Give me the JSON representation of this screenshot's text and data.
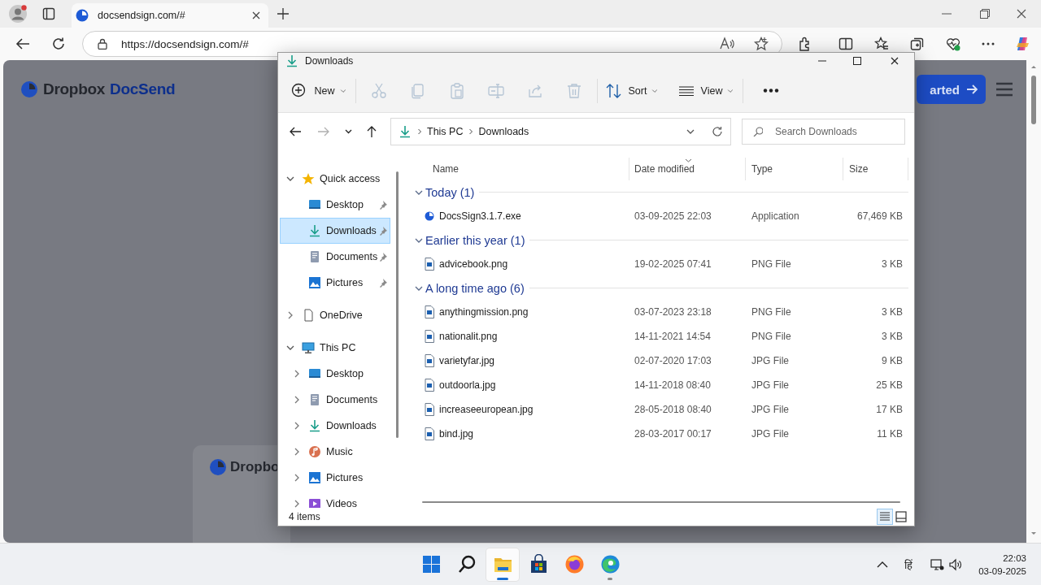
{
  "browser": {
    "tab_title": "docsendsign.com/#",
    "url": "https://docsendsign.com/#"
  },
  "webpage": {
    "logo_brand": "Dropbox",
    "logo_product": "DocSend",
    "header_button": "arted",
    "card_logo": "Dropbo"
  },
  "explorer": {
    "title": "Downloads",
    "toolbar": [
      {
        "kind": "new",
        "label": "New",
        "disabled": false
      },
      {
        "kind": "cut",
        "disabled": true
      },
      {
        "kind": "copy",
        "disabled": true
      },
      {
        "kind": "paste",
        "disabled": true
      },
      {
        "kind": "rename",
        "disabled": true
      },
      {
        "kind": "share",
        "disabled": true
      },
      {
        "kind": "delete",
        "disabled": true
      },
      {
        "kind": "sort",
        "label": "Sort",
        "disabled": false
      },
      {
        "kind": "view",
        "label": "View",
        "disabled": false
      },
      {
        "kind": "more",
        "disabled": false
      }
    ],
    "nav_buttons": [
      {
        "kind": "back",
        "disabled": false
      },
      {
        "kind": "forward",
        "disabled": true
      },
      {
        "kind": "recent",
        "disabled": false
      },
      {
        "kind": "up",
        "disabled": false
      }
    ],
    "breadcrumb": [
      "This PC",
      "Downloads"
    ],
    "search": {
      "placeholder": "Search Downloads"
    },
    "sidebar": [
      {
        "label": "Quick access",
        "kind": "star",
        "expanded": true,
        "selected": false,
        "children": [
          {
            "label": "Desktop",
            "kind": "desktop",
            "pinned": true,
            "selected": false
          },
          {
            "label": "Downloads",
            "kind": "download",
            "pinned": true,
            "selected": true
          },
          {
            "label": "Documents",
            "kind": "documents",
            "pinned": true,
            "selected": false
          },
          {
            "label": "Pictures",
            "kind": "pictures",
            "pinned": true,
            "selected": false
          }
        ]
      },
      {
        "label": "OneDrive",
        "kind": "file",
        "expanded": false,
        "selected": false
      },
      {
        "label": "This PC",
        "kind": "pc",
        "expanded": true,
        "selected": false,
        "children": [
          {
            "label": "Desktop",
            "kind": "desktop",
            "expanded": false,
            "selected": false
          },
          {
            "label": "Documents",
            "kind": "documents",
            "expanded": false,
            "selected": false
          },
          {
            "label": "Downloads",
            "kind": "download",
            "expanded": false,
            "selected": false
          },
          {
            "label": "Music",
            "kind": "music",
            "expanded": false,
            "selected": false
          },
          {
            "label": "Pictures",
            "kind": "pictures",
            "expanded": false,
            "selected": false
          },
          {
            "label": "Videos",
            "kind": "videos",
            "expanded": false,
            "selected": false
          }
        ]
      }
    ],
    "columns": [
      {
        "label": "Name",
        "sorted": false
      },
      {
        "label": "Date modified",
        "sorted": true
      },
      {
        "label": "Type",
        "sorted": false
      },
      {
        "label": "Size",
        "sorted": false
      }
    ],
    "groups": [
      {
        "label": "Today (1)",
        "expanded": true,
        "files": [
          {
            "name": "DocsSign3.1.7.exe",
            "kind": "app",
            "date": "03-09-2025 22:03",
            "type": "Application",
            "size": "67,469 KB"
          }
        ]
      },
      {
        "label": "Earlier this year (1)",
        "expanded": true,
        "files": [
          {
            "name": "advicebook.png",
            "kind": "image",
            "date": "19-02-2025 07:41",
            "type": "PNG File",
            "size": "3 KB"
          }
        ]
      },
      {
        "label": "A long time ago (6)",
        "expanded": true,
        "files": [
          {
            "name": "anythingmission.png",
            "kind": "image",
            "date": "03-07-2023 23:18",
            "type": "PNG File",
            "size": "3 KB"
          },
          {
            "name": "nationalit.png",
            "kind": "image",
            "date": "14-11-2021 14:54",
            "type": "PNG File",
            "size": "3 KB"
          },
          {
            "name": "varietyfar.jpg",
            "kind": "image",
            "date": "02-07-2020 17:03",
            "type": "JPG File",
            "size": "9 KB"
          },
          {
            "name": "outdoorla.jpg",
            "kind": "image",
            "date": "14-11-2018 08:40",
            "type": "JPG File",
            "size": "25 KB"
          },
          {
            "name": "increaseeuropean.jpg",
            "kind": "image",
            "date": "28-05-2018 08:40",
            "type": "JPG File",
            "size": "17 KB"
          },
          {
            "name": "bind.jpg",
            "kind": "image",
            "date": "28-03-2017 00:17",
            "type": "JPG File",
            "size": "11 KB"
          }
        ]
      }
    ],
    "status": "4 items",
    "view_modes": [
      {
        "kind": "details",
        "selected": true
      },
      {
        "kind": "tiles",
        "selected": false
      }
    ]
  },
  "taskbar": {
    "apps": [
      {
        "kind": "start",
        "active": false,
        "running": false
      },
      {
        "kind": "search",
        "active": false,
        "running": false
      },
      {
        "kind": "explorer",
        "active": true,
        "running": true
      },
      {
        "kind": "store",
        "active": false,
        "running": false
      },
      {
        "kind": "firefox",
        "active": false,
        "running": false
      },
      {
        "kind": "edge",
        "active": false,
        "running": true
      }
    ],
    "language": "हिं",
    "time": "22:03",
    "date": "03-09-2025"
  }
}
